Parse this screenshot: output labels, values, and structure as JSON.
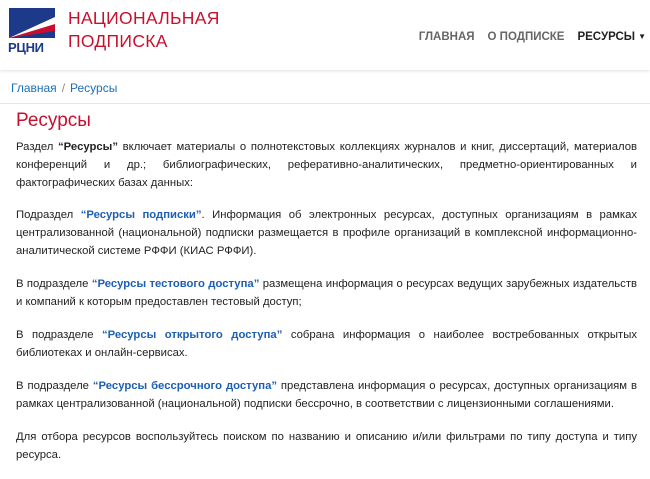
{
  "brand": {
    "logo_abbr": "РЦНИ",
    "name_line1": "НАЦИОНАЛЬНАЯ",
    "name_line2": "ПОДПИСКА",
    "accent_color": "#c8102e",
    "logo_blue": "#1d3a8a"
  },
  "nav": {
    "items": [
      {
        "label": "ГЛАВНАЯ"
      },
      {
        "label": "О ПОДПИСКЕ"
      },
      {
        "label": "РЕСУРСЫ"
      }
    ]
  },
  "breadcrumb": {
    "home": "Главная",
    "separator": "/",
    "current": "Ресурсы"
  },
  "page": {
    "title": "Ресурсы",
    "p1": {
      "before": "Раздел ",
      "bold": "“Ресурсы”",
      "after": " включает материалы о полнотекстовых коллекциях журналов и книг, диссертаций, материалов конференций и др.; библиографических, реферативно-аналитических, предметно-ориентированных и фактографических базах данных:"
    },
    "p2": {
      "before": "Подраздел ",
      "link": "“Ресурсы подписки”",
      "after": ". Информация об электронных ресурсах, доступных организациям в рамках централизованной (национальной) подписки размещается в профиле организаций в комплексной информационно-аналитической системе РФФИ (КИАС РФФИ)."
    },
    "p3": {
      "before": "В подразделе ",
      "link": "“Ресурсы тестового доступа”",
      "after": " размещена информация о ресурсах ведущих зарубежных издательств и компаний к которым предоставлен тестовый доступ;"
    },
    "p4": {
      "before": "В подразделе ",
      "link": "“Ресурсы открытого доступа”",
      "after": " собрана информация о наиболее востребованных открытых библиотеках и онлайн-сервисах."
    },
    "p5": {
      "before": "В подразделе ",
      "link": "“Ресурсы бессрочного доступа”",
      "after": " представлена информация о ресурсах, доступных организациям в рамках централизованной (национальной) подписки бессрочно, в соответствии с лицензионными соглашениями."
    },
    "p6": {
      "text": "Для отбора ресурсов воспользуйтесь поиском по названию и описанию и/или фильтрами по типу доступа и типу ресурса."
    }
  }
}
